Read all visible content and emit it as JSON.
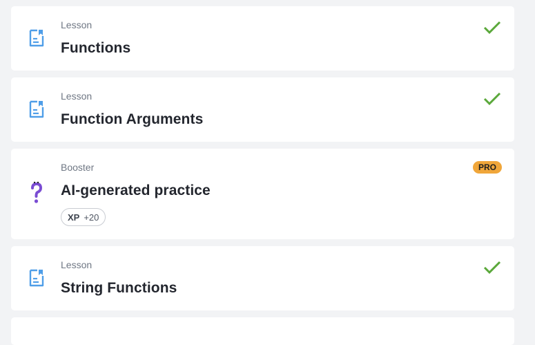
{
  "cards": [
    {
      "eyebrow": "Lesson",
      "title": "Functions",
      "icon": "document-icon",
      "status": "completed"
    },
    {
      "eyebrow": "Lesson",
      "title": "Function Arguments",
      "icon": "document-icon",
      "status": "completed"
    },
    {
      "eyebrow": "Booster",
      "title": "AI-generated practice",
      "icon": "question-mark-icon",
      "badge": "PRO",
      "xp_label": "XP",
      "xp_value": "+20"
    },
    {
      "eyebrow": "Lesson",
      "title": "String Functions",
      "icon": "document-icon",
      "status": "completed"
    }
  ],
  "colors": {
    "background": "#f2f3f5",
    "card": "#ffffff",
    "check": "#5aa83a",
    "document_icon": "#4f9ee8",
    "question_icon": "#7a4cd3",
    "pro_badge": "#f0a63a"
  }
}
